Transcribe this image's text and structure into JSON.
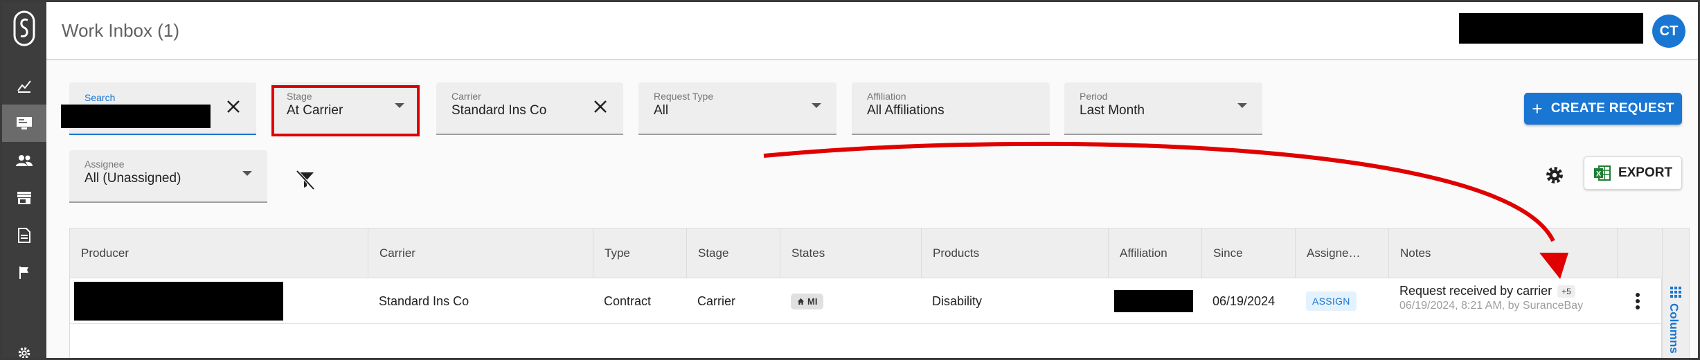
{
  "header": {
    "title": "Work Inbox (1)",
    "avatar_initials": "CT"
  },
  "filters": {
    "search": {
      "label": "Search",
      "value": ""
    },
    "stage": {
      "label": "Stage",
      "value": "At Carrier"
    },
    "carrier": {
      "label": "Carrier",
      "value": "Standard Ins Co"
    },
    "request_type": {
      "label": "Request Type",
      "value": "All"
    },
    "affiliation": {
      "label": "Affiliation",
      "value": "All Affiliations"
    },
    "period": {
      "label": "Period",
      "value": "Last Month"
    },
    "assignee": {
      "label": "Assignee",
      "value": "All (Unassigned)"
    }
  },
  "actions": {
    "create_request": "CREATE REQUEST",
    "export": "EXPORT"
  },
  "table": {
    "columns": [
      "Producer",
      "Carrier",
      "Type",
      "Stage",
      "States",
      "Products",
      "Affiliation",
      "Since",
      "Assigne…",
      "Notes"
    ],
    "rows": [
      {
        "carrier": "Standard Ins Co",
        "type": "Contract",
        "stage": "Carrier",
        "state": "MI",
        "products": "Disability",
        "since": "06/19/2024",
        "assignee_action": "ASSIGN",
        "note_main": "Request received by carrier",
        "note_more": "+5",
        "note_sub": "06/19/2024, 8:21 AM, by SuranceBay"
      }
    ],
    "columns_tab_label": "Columns"
  },
  "colors": {
    "accent": "#1976d2",
    "nav_bg": "#3d3d3d",
    "annotation": "#e00000"
  }
}
